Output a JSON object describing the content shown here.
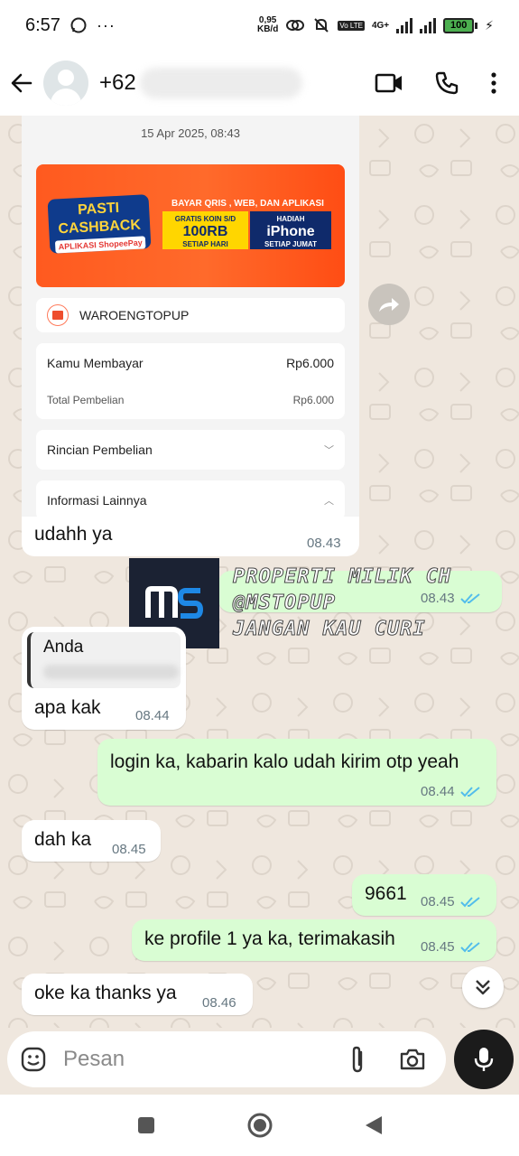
{
  "status_bar": {
    "time": "6:57",
    "speed_value": "0,95",
    "speed_unit": "KB/d",
    "network": "4G+",
    "battery": "100"
  },
  "header": {
    "contact_prefix": "+62"
  },
  "receipt": {
    "date": "15 Apr 2025, 08:43",
    "banner": {
      "pasti": "PASTI",
      "cashback": "CASHBACK",
      "aplikasi": "APLIKASI",
      "shopeepay": "ShopeePay",
      "bayar": "BAYAR QRIS , WEB, DAN APLIKASI",
      "koin_top": "GRATIS KOIN S/D",
      "koin_amount": "100RB",
      "koin_bottom": "SETIAP HARI",
      "hadiah": "HADIAH",
      "iphone": "iPhone",
      "jumat": "SETIAP JUMAT"
    },
    "merchant": "WAROENGTOPUP",
    "paid_label": "Kamu Membayar",
    "paid_value": "Rp6.000",
    "total_label": "Total Pembelian",
    "total_value": "Rp6.000",
    "details_label": "Rincian Pembelian",
    "info_label": "Informasi Lainnya"
  },
  "watermark": {
    "logo": "MS",
    "lines": [
      "PROPERTI MILIK CH",
      "@MSTOPUP",
      "JANGAN KAU CURI"
    ]
  },
  "messages": [
    {
      "dir": "in",
      "text": "udahh ya",
      "time": "08.43"
    },
    {
      "dir": "out",
      "text": "",
      "time": "08.43"
    },
    {
      "dir": "in",
      "quote_author": "Anda",
      "text": "apa kak",
      "time": "08.44"
    },
    {
      "dir": "out",
      "text": "login ka, kabarin kalo udah kirim otp yeah",
      "time": "08.44"
    },
    {
      "dir": "in",
      "text": "dah ka",
      "time": "08.45"
    },
    {
      "dir": "out",
      "text": "9661",
      "time": "08.45"
    },
    {
      "dir": "out",
      "text": "ke profile 1 ya ka, terimakasih",
      "time": "08.45"
    },
    {
      "dir": "in",
      "text": "oke ka thanks ya",
      "time": "08.46"
    }
  ],
  "composer": {
    "placeholder": "Pesan"
  },
  "colors": {
    "outgoing": "#d9fdd3",
    "incoming": "#ffffff",
    "read_tick": "#53bdeb",
    "wallpaper": "#efe7de"
  }
}
